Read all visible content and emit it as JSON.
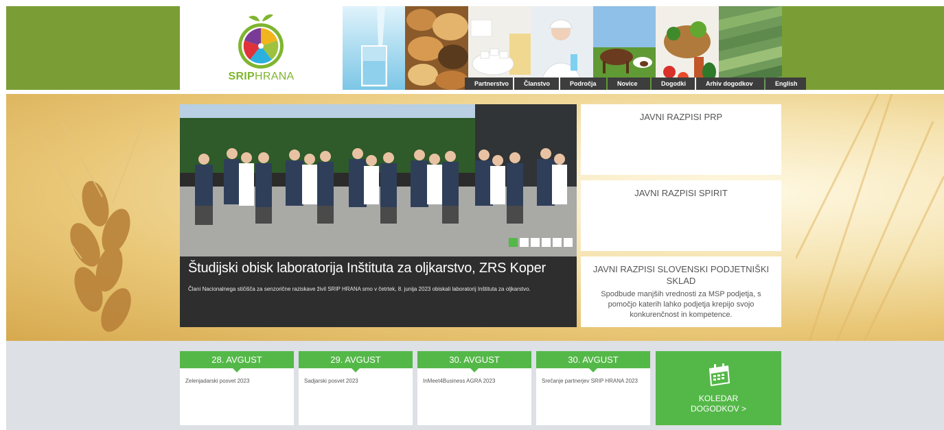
{
  "logo": {
    "text_bold": "SRIP",
    "text_regular": "HRANA"
  },
  "nav": {
    "items": [
      "Partnerstvo",
      "Članstvo",
      "Področja",
      "Novice",
      "Dogodki",
      "Arhiv dogodkov",
      "English"
    ]
  },
  "slider": {
    "title": "Študijski obisk laboratorija Inštituta za oljkarstvo, ZRS Koper",
    "text": "Člani Nacionalnega stičišča za senzorične raziskave živil SRIP HRANA smo v četrtek, 8. junija 2023 obiskali laboratorij Inštituta za oljkarstvo.",
    "dots_count": 6,
    "active_dot": 1
  },
  "side_boxes": [
    {
      "title": "JAVNI RAZPISI PRP",
      "desc": ""
    },
    {
      "title": "JAVNI RAZPISI SPIRIT",
      "desc": ""
    },
    {
      "title": "JAVNI RAZPISI SLOVENSKI PODJETNIŠKI SKLAD",
      "desc": "Spodbude manjših vrednosti za MSP podjetja, s pomočjo katerih lahko podjetja krepijo svojo konkurenčnost in kompetence."
    }
  ],
  "events": [
    {
      "date": "28. AVGUST",
      "title": "Zelenjadarski posvet 2023"
    },
    {
      "date": "29. AVGUST",
      "title": "Sadjarski posvet 2023"
    },
    {
      "date": "30. AVGUST",
      "title": "InMeet4Business AGRA 2023"
    },
    {
      "date": "30. AVGUST",
      "title": "Srečanje partnerjev SRIP HRANA 2023"
    }
  ],
  "calendar": {
    "line1": "KOLEDAR",
    "line2": "DOGODKOV >",
    "icon": "calendar-icon"
  },
  "colors": {
    "header_green": "#7a9e35",
    "accent_green": "#54b848",
    "nav_dark": "#3d3d3d",
    "events_bg": "#dde0e4"
  }
}
